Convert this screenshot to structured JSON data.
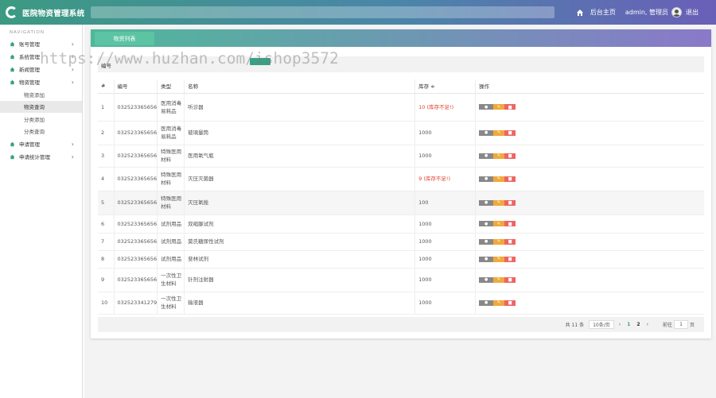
{
  "header": {
    "title": "医院物资管理系统",
    "home_label": "后台主页",
    "user_label": "admin, 管理员",
    "logout_label": "退出"
  },
  "sidebar": {
    "heading": "NAVIGATION",
    "items": [
      {
        "label": "账号管理"
      },
      {
        "label": "系统管理"
      },
      {
        "label": "新闻管理"
      },
      {
        "label": "物资管理"
      }
    ],
    "sub_items": [
      {
        "label": "物资添加"
      },
      {
        "label": "物资查询"
      },
      {
        "label": "分类添加"
      },
      {
        "label": "分类查询"
      }
    ],
    "items_after": [
      {
        "label": "申请管理"
      },
      {
        "label": "申请统计管理"
      }
    ]
  },
  "panel": {
    "tab_label": "物资列表",
    "search_label": "编号"
  },
  "table": {
    "headers": [
      "#",
      "编号",
      "类型",
      "名称",
      "库存 ≑",
      "操作"
    ],
    "rows": [
      {
        "idx": "1",
        "code": "032523365656",
        "type": "医用消毒易耗品",
        "name": "听诊器",
        "stock": "10 (库存不足!)",
        "warn": true
      },
      {
        "idx": "2",
        "code": "032523365656",
        "type": "医用消毒易耗品",
        "name": "玻璃量筒",
        "stock": "1000",
        "warn": false
      },
      {
        "idx": "3",
        "code": "032523365656",
        "type": "特殊医用材料",
        "name": "医用氧气瓶",
        "stock": "1000",
        "warn": false
      },
      {
        "idx": "4",
        "code": "032523365656",
        "type": "特殊医用材料",
        "name": "灭压灭菌器",
        "stock": "9 (库存不足!)",
        "warn": true
      },
      {
        "idx": "5",
        "code": "032523365656",
        "type": "特殊医用材料",
        "name": "灭压氧舱",
        "stock": "100",
        "warn": false
      },
      {
        "idx": "6",
        "code": "032523365656",
        "type": "试剂用品",
        "name": "双缩脲试剂",
        "stock": "1000",
        "warn": false
      },
      {
        "idx": "7",
        "code": "032523365656",
        "type": "试剂用品",
        "name": "莫氏糖尿性试剂",
        "stock": "1000",
        "warn": false
      },
      {
        "idx": "8",
        "code": "032523365656",
        "type": "试剂用品",
        "name": "斐林试剂",
        "stock": "1000",
        "warn": false
      },
      {
        "idx": "9",
        "code": "032523365656",
        "type": "一次性卫生材料",
        "name": "针剂注射器",
        "stock": "1000",
        "warn": false
      },
      {
        "idx": "10",
        "code": "032523341279",
        "type": "一次性卫生材料",
        "name": "输液器",
        "stock": "1000",
        "warn": false
      }
    ],
    "op_icons": [
      "eye-icon",
      "pencil-icon",
      "trash-icon"
    ]
  },
  "pager": {
    "total": "共 11 条",
    "per_page": "10条/页",
    "prev": "‹",
    "pages": [
      "1",
      "2"
    ],
    "next": "›",
    "goto_prefix": "前往",
    "goto_value": "1",
    "goto_suffix": "页"
  },
  "watermark": "https://www.huzhan.com/ishop3572",
  "colors": {
    "accent": "#3aa185",
    "warn": "#e2412b",
    "edit": "#f0a93a",
    "delete": "#ef6462"
  }
}
